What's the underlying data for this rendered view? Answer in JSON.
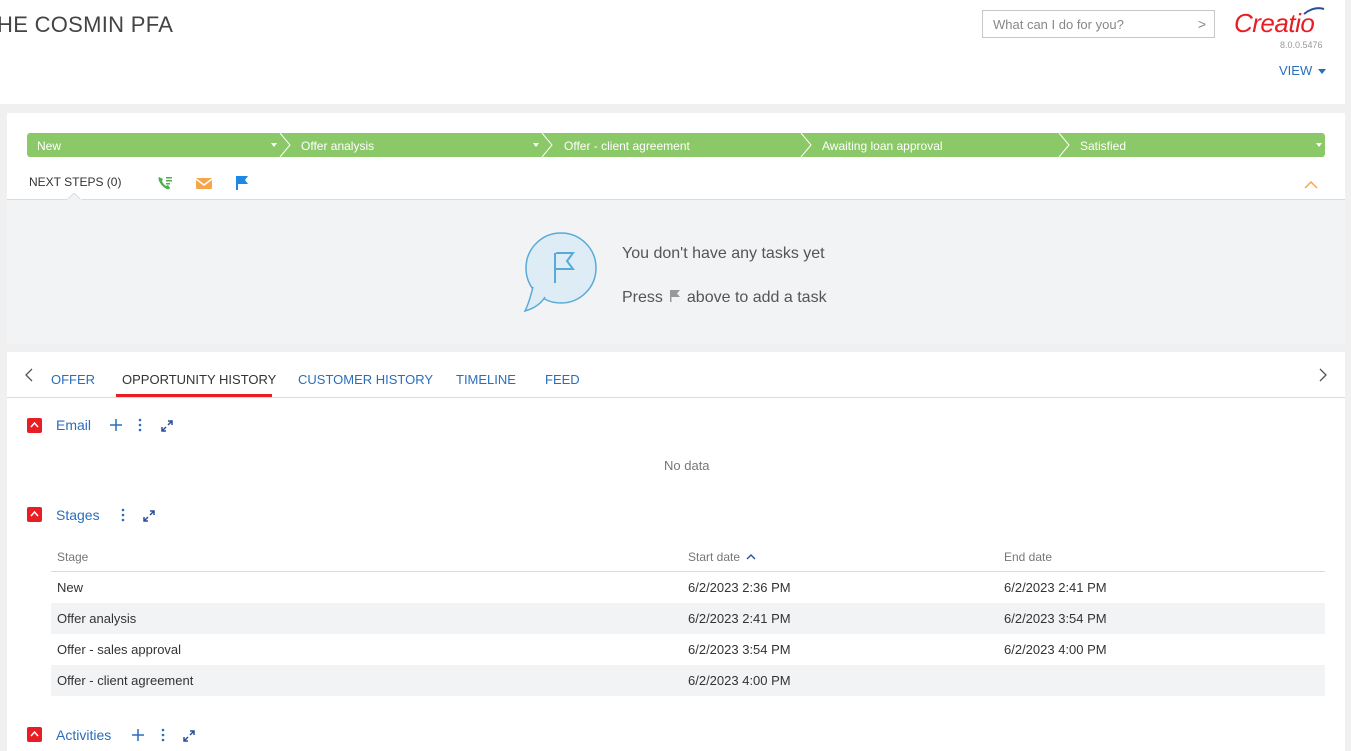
{
  "header": {
    "title": "HE COSMIN PFA",
    "search_placeholder": "What can I do for you?",
    "logo_text": "Creatio",
    "version": "8.0.0.5476",
    "view_label": "VIEW"
  },
  "stages": [
    {
      "label": "New",
      "has_dropdown": true
    },
    {
      "label": "Offer analysis",
      "has_dropdown": true
    },
    {
      "label": "Offer - client agreement",
      "has_dropdown": false
    },
    {
      "label": "Awaiting loan approval",
      "has_dropdown": false
    },
    {
      "label": "Satisfied",
      "has_dropdown": true
    }
  ],
  "next_steps": {
    "label": "NEXT STEPS (0)",
    "icons": [
      "phone-list-icon",
      "email-icon",
      "flag-icon"
    ],
    "empty_title": "You don't have any tasks yet",
    "empty_hint_before": "Press",
    "empty_hint_after": "above to add a task"
  },
  "tabs": [
    {
      "label": "OFFER",
      "active": false
    },
    {
      "label": "OPPORTUNITY HISTORY",
      "active": true
    },
    {
      "label": "CUSTOMER HISTORY",
      "active": false
    },
    {
      "label": "TIMELINE",
      "active": false
    },
    {
      "label": "FEED",
      "active": false
    }
  ],
  "sections": {
    "email": {
      "title": "Email",
      "empty": "No data"
    },
    "stages": {
      "title": "Stages",
      "columns": [
        "Stage",
        "Start date",
        "End date"
      ],
      "rows": [
        [
          "New",
          "6/2/2023 2:36 PM",
          "6/2/2023 2:41 PM"
        ],
        [
          "Offer analysis",
          "6/2/2023 2:41 PM",
          "6/2/2023 3:54 PM"
        ],
        [
          "Offer - sales approval",
          "6/2/2023 3:54 PM",
          "6/2/2023 4:00 PM"
        ],
        [
          "Offer - client agreement",
          "6/2/2023 4:00 PM",
          ""
        ]
      ]
    },
    "activities": {
      "title": "Activities"
    }
  },
  "colors": {
    "accent_red": "#e81e25",
    "link_blue": "#2a6ebb",
    "stage_green": "#8bc868"
  }
}
